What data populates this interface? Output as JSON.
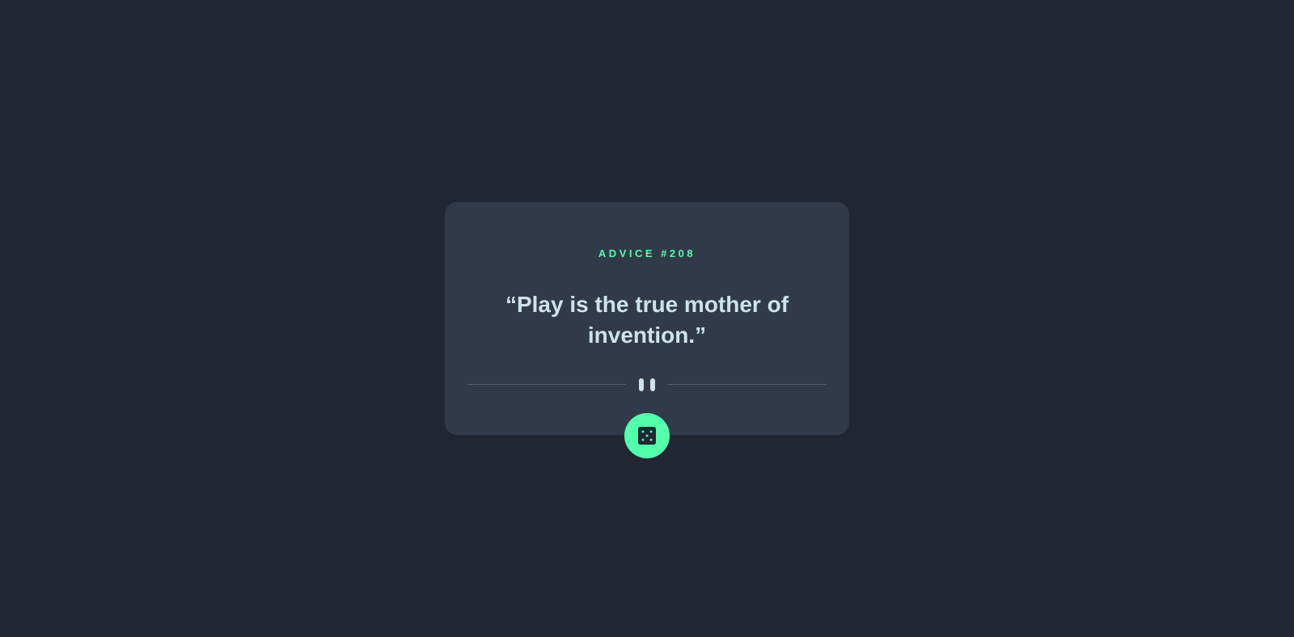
{
  "advice": {
    "label": "ADVICE #208",
    "quote": "“Play is the true mother of invention.”"
  },
  "icons": {
    "divider": "pause-icon",
    "button": "dice-icon"
  },
  "colors": {
    "background": "#202733",
    "card": "#313A48",
    "accent": "#53FFAA",
    "text": "#CEE3E9",
    "divider": "#4F5D74"
  }
}
